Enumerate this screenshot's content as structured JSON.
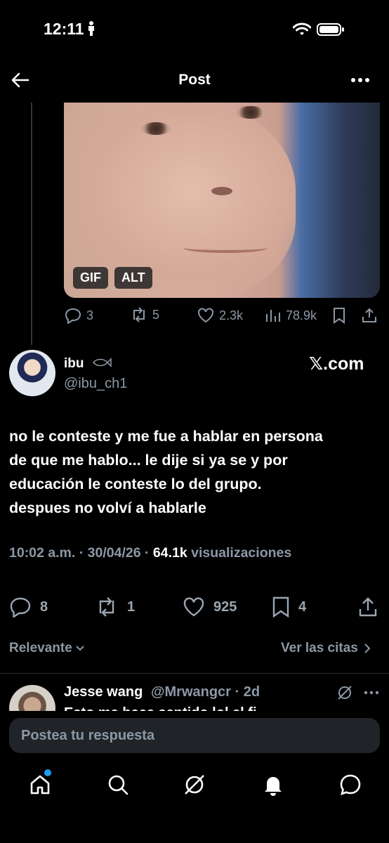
{
  "status_bar": {
    "time": "12:11"
  },
  "header": {
    "title": "Post"
  },
  "quoted_media": {
    "badges": [
      "GIF",
      "ALT"
    ],
    "stats": {
      "replies": "3",
      "reposts": "5",
      "likes": "2.3k",
      "views": "78.9k"
    }
  },
  "post": {
    "author_name": "ibu",
    "author_handle": "@ibu_ch1",
    "source_logo": "𝕏.com",
    "text_lines": [
      "no le conteste y me fue a hablar en persona",
      "de que me hablo... le dije si ya se y por",
      "educación le conteste lo del grupo.",
      "despues no volví a hablarle"
    ],
    "time": "10:02 a.m.",
    "date": "30/04/26",
    "views_count": "64.1k",
    "views_label": "visualizaciones",
    "actions": {
      "replies": "8",
      "reposts": "1",
      "likes": "925",
      "bookmarks": "4"
    }
  },
  "sort": {
    "relevant_label": "Relevante",
    "quotes_label": "Ver las citas"
  },
  "reply": {
    "name": "Jesse wang",
    "handle_time": "@Mrwangcr · 2d",
    "preview": "Esto me hace sentido lol el fi"
  },
  "compose": {
    "placeholder": "Postea tu respuesta"
  },
  "tab_bar": {
    "items": [
      "home",
      "search",
      "grok",
      "notifications",
      "messages"
    ]
  },
  "colors": {
    "background": "#000000",
    "muted": "#71767b",
    "accent": "#1d9bf0"
  }
}
